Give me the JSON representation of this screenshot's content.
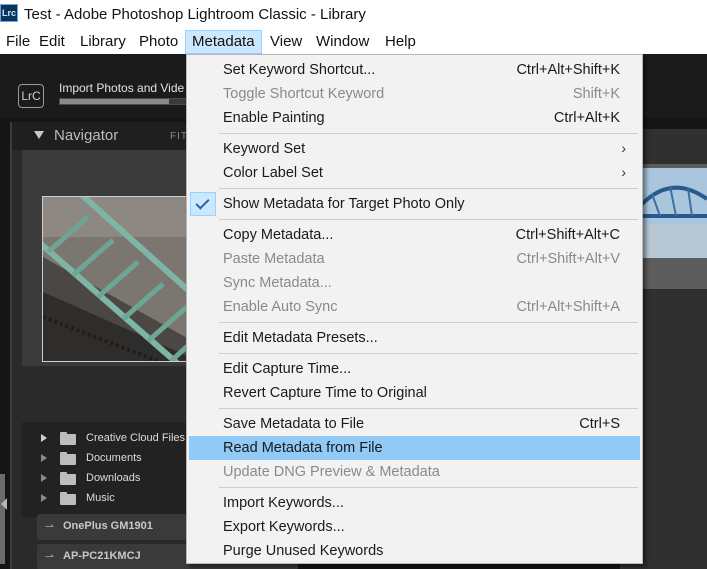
{
  "window": {
    "title": "Test - Adobe Photoshop Lightroom Classic - Library",
    "app_icon_text": "Lrc"
  },
  "menubar": {
    "items": [
      "File",
      "Edit",
      "Library",
      "Photo",
      "Metadata",
      "View",
      "Window",
      "Help"
    ],
    "active": "Metadata"
  },
  "lightroom": {
    "logo_text": "LrC",
    "import": {
      "label": "Import Photos and Vide",
      "progress": 0.85
    },
    "navigator": {
      "title": "Navigator",
      "fit": "FIT"
    },
    "folders": [
      {
        "label": "Creative Cloud Files",
        "expanded": true
      },
      {
        "label": "Documents",
        "expanded": false
      },
      {
        "label": "Downloads",
        "expanded": false
      },
      {
        "label": "Music",
        "expanded": false
      }
    ],
    "volumes": [
      "OnePlus GM1901",
      "AP-PC21KMCJ"
    ]
  },
  "metadata_menu": {
    "items": [
      {
        "label": "Set Keyword Shortcut...",
        "shortcut": "Ctrl+Alt+Shift+K",
        "enabled": true
      },
      {
        "label": "Toggle Shortcut Keyword",
        "shortcut": "Shift+K",
        "enabled": false
      },
      {
        "label": "Enable Painting",
        "shortcut": "Ctrl+Alt+K",
        "enabled": true
      },
      {
        "label": "Keyword Set",
        "submenu": true,
        "enabled": true
      },
      {
        "label": "Color Label Set",
        "submenu": true,
        "enabled": true
      },
      {
        "label": "Show Metadata for Target Photo Only",
        "checked": true,
        "enabled": true
      },
      {
        "label": "Copy Metadata...",
        "shortcut": "Ctrl+Shift+Alt+C",
        "enabled": true
      },
      {
        "label": "Paste Metadata",
        "shortcut": "Ctrl+Shift+Alt+V",
        "enabled": false
      },
      {
        "label": "Sync Metadata...",
        "enabled": false
      },
      {
        "label": "Enable Auto Sync",
        "shortcut": "Ctrl+Alt+Shift+A",
        "enabled": false
      },
      {
        "label": "Edit Metadata Presets...",
        "enabled": true
      },
      {
        "label": "Edit Capture Time...",
        "enabled": true
      },
      {
        "label": "Revert Capture Time to Original",
        "enabled": true
      },
      {
        "label": "Save Metadata to File",
        "shortcut": "Ctrl+S",
        "enabled": true
      },
      {
        "label": "Read Metadata from File",
        "enabled": true,
        "highlighted": true
      },
      {
        "label": "Update DNG Preview & Metadata",
        "enabled": false
      },
      {
        "label": "Import Keywords...",
        "enabled": true
      },
      {
        "label": "Export Keywords...",
        "enabled": true
      },
      {
        "label": "Purge Unused Keywords",
        "enabled": true
      }
    ],
    "submenu_glyph": "›"
  },
  "colors": {
    "menu_highlight": "#91c9f7",
    "active_menu": "#cce8ff",
    "disabled_text": "#8a8a8a",
    "panel_dark": "#151515"
  }
}
